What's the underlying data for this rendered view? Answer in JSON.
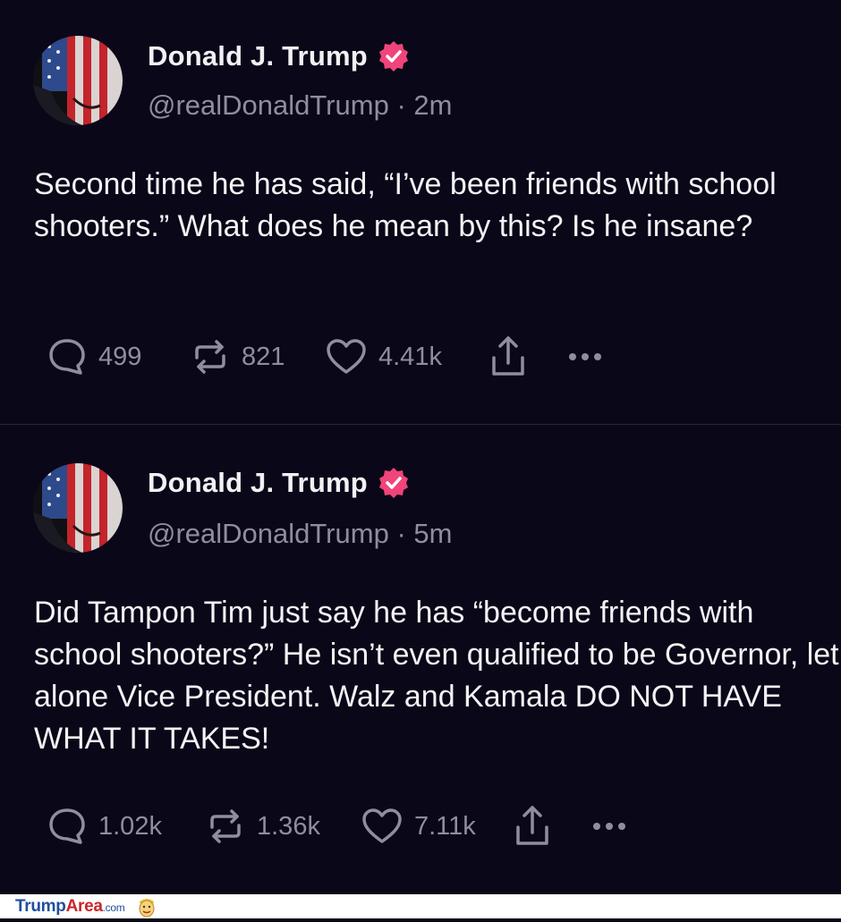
{
  "posts": [
    {
      "author_name": "Donald J. Trump",
      "handle": "@realDonaldTrump",
      "separator": "·",
      "time": "2m",
      "text": "Second time he has said, “I’ve been friends with school shooters.” What does he mean by this? Is he insane?",
      "replies": "499",
      "reposts": "821",
      "likes": "4.41k"
    },
    {
      "author_name": "Donald J. Trump",
      "handle": "@realDonaldTrump",
      "separator": "·",
      "time": "5m",
      "text": "Did Tampon Tim just say he has “become friends with school shooters?” He isn’t even qualified to be Governor, let alone Vice President. Walz and Kamala DO NOT HAVE WHAT IT TAKES!",
      "replies": "1.02k",
      "reposts": "1.36k",
      "likes": "7.11k"
    }
  ],
  "footer": {
    "logo_part1": "Trump",
    "logo_part2": "Area",
    "logo_part3": ".com"
  },
  "colors": {
    "background": "#0a0718",
    "badge": "#f0447a",
    "muted_text": "#8f8e9c",
    "primary_text": "#f3f3f5"
  },
  "icons": [
    "verified-badge-icon",
    "reply-icon",
    "repost-icon",
    "like-icon",
    "share-icon",
    "more-icon",
    "mascot-icon"
  ]
}
